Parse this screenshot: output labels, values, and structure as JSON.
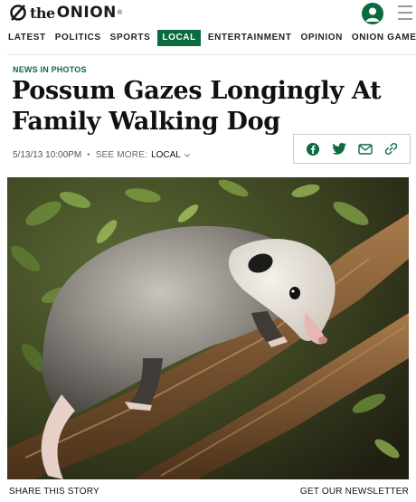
{
  "brand": {
    "the": "the",
    "onion": "ONION",
    "reg": "®"
  },
  "nav": {
    "items": [
      "LATEST",
      "POLITICS",
      "SPORTS",
      "LOCAL",
      "ENTERTAINMENT",
      "OPINION",
      "ONION GAMERS"
    ],
    "active": "LOCAL"
  },
  "article": {
    "kicker": "NEWS IN PHOTOS",
    "headline": "Possum Gazes Longingly At Family Walking Dog",
    "timestamp": "5/13/13 10:00PM",
    "see_more_label": "SEE MORE:",
    "section": "LOCAL"
  },
  "share_icons": [
    "facebook-icon",
    "twitter-icon",
    "email-icon",
    "link-icon"
  ],
  "footer": {
    "share_label": "SHARE THIS STORY",
    "newsletter_label": "GET OUR NEWSLETTER"
  },
  "colors": {
    "accent": "#0c6b3e",
    "text": "#111111"
  }
}
